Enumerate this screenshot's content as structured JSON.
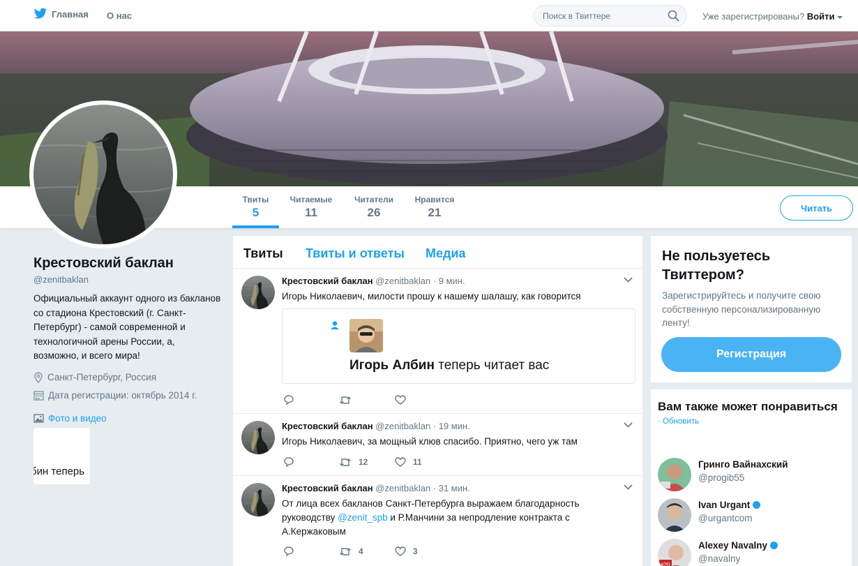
{
  "nav": {
    "home_label": "Главная",
    "about_label": "О нас",
    "search_placeholder": "Поиск в Твиттере",
    "login_prompt": "Уже зарегистрированы?",
    "login_link": "Войти"
  },
  "profile": {
    "name": "Крестовский баклан",
    "handle": "@zenitbaklan",
    "bio": "Официальный аккаунт одного из бакланов со стадиона Крестовский (г. Санкт-Петербург) - самой современной и технологичной арены России, а, возможно, и всего мира!",
    "location": "Санкт-Петербург, Россия",
    "joined": "Дата регистрации: октябрь 2014 г.",
    "media_label": "Фото и видео",
    "media_thumb_text": "бин теперь"
  },
  "stats": [
    {
      "label": "Твиты",
      "value": "5"
    },
    {
      "label": "Читаемые",
      "value": "11"
    },
    {
      "label": "Читатели",
      "value": "26"
    },
    {
      "label": "Нравится",
      "value": "21"
    }
  ],
  "follow_label": "Читать",
  "tabs": [
    "Твиты",
    "Твиты и ответы",
    "Медиа"
  ],
  "tweets": [
    {
      "name": "Крестовский баклан",
      "handle": "@zenitbaklan",
      "time": "· 9 мин.",
      "text": "Игорь Николаевич, милости прошу к нашему шалашу, как говорится",
      "card_name": "Игорь Албин",
      "card_suffix": " теперь читает вас",
      "retweets": "",
      "likes": ""
    },
    {
      "name": "Крестовский баклан",
      "handle": "@zenitbaklan",
      "time": "· 19 мин.",
      "text": "Игорь Николаевич, за мощный клюв спасибо. Приятно, чего уж там",
      "retweets": "12",
      "likes": "11"
    },
    {
      "name": "Крестовский баклан",
      "handle": "@zenitbaklan",
      "time": "· 31 мин.",
      "text_before": "От лица всех бакланов Санкт-Петербурга выражаем благодарность руководству ",
      "mention": "@zenit_spb",
      "text_after": " и Р.Манчини за непродление контракта с А.Кержаковым",
      "retweets": "4",
      "likes": "3"
    }
  ],
  "signup": {
    "title": "Не пользуетесь Твиттером?",
    "text": "Зарегистрируйтесь и получите свою собственную персонализированную ленту!",
    "button": "Регистрация"
  },
  "wtf": {
    "title": "Вам также может понравиться",
    "refresh": "· Обновить",
    "users": [
      {
        "name": "Гринго Вайнахский",
        "handle": "@progib55",
        "verified": false
      },
      {
        "name": "Ivan Urgant",
        "handle": "@urgantcom",
        "verified": true
      },
      {
        "name": "Alexey Navalny",
        "handle": "@navalny",
        "verified": true
      }
    ]
  },
  "colors": {
    "accent": "#1da1f2",
    "background": "#e6ecf0",
    "muted": "#657786"
  }
}
